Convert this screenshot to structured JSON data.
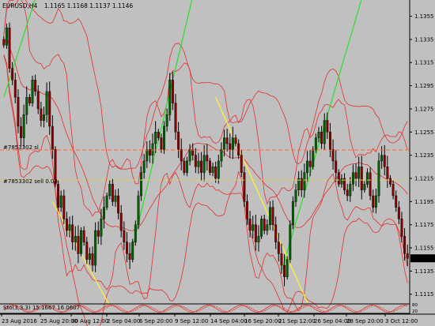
{
  "header": {
    "symbol_tf": "EURUSD,H4",
    "ohlc": "1.1165 1.1168 1.1137 1.1146"
  },
  "orders": {
    "sl_label": "#7853302 sl",
    "sell_label": "#7853302 sell 0.03"
  },
  "current_price": "1.1146",
  "oscillator_label": "Sto(3,3,3) 15.1667 16.0607",
  "osc_levels": [
    "80",
    "20"
  ],
  "colors": {
    "background": "#c0c0c0",
    "bull_candle": "#006400",
    "bear_candle": "#8b0000",
    "bands": "#e03030",
    "green_line": "#33dd33",
    "yellow_line": "#ffee33",
    "sl_line": "#ff6a3d",
    "order_line": "#e0d060",
    "price_box": "#000000"
  },
  "chart_data": {
    "type": "candlestick",
    "symbol": "EURUSD",
    "timeframe": "H4",
    "y_ticks": [
      "1.1355",
      "1.1335",
      "1.1315",
      "1.1295",
      "1.1275",
      "1.1255",
      "1.1235",
      "1.1215",
      "1.1195",
      "1.1175",
      "1.1155",
      "1.1135",
      "1.1115"
    ],
    "x_ticks": [
      "23 Aug 2016",
      "25 Aug 20:00",
      "30 Aug 12:00",
      "2 Sep 04:00",
      "6 Sep 20:00",
      "9 Sep 12:00",
      "14 Sep 04:00",
      "16 Sep 20:00",
      "21 Sep 12:00",
      "26 Sep 04:00",
      "28 Sep 20:00",
      "3 Oct 12:00"
    ],
    "ylim": [
      1.1108,
      1.1369
    ],
    "sl_price": 1.12395,
    "order_price": 1.12135,
    "closes": [
      1.133,
      1.1345,
      1.131,
      1.13,
      1.1285,
      1.126,
      1.125,
      1.127,
      1.1285,
      1.128,
      1.13,
      1.129,
      1.1275,
      1.1265,
      1.127,
      1.129,
      1.126,
      1.124,
      1.121,
      1.119,
      1.12,
      1.118,
      1.117,
      1.1175,
      1.116,
      1.1165,
      1.115,
      1.117,
      1.116,
      1.1145,
      1.115,
      1.114,
      1.117,
      1.1165,
      1.118,
      1.119,
      1.12,
      1.121,
      1.1195,
      1.12,
      1.1185,
      1.117,
      1.116,
      1.115,
      1.1145,
      1.116,
      1.1175,
      1.12,
      1.122,
      1.123,
      1.124,
      1.1235,
      1.1245,
      1.1255,
      1.125,
      1.124,
      1.126,
      1.127,
      1.13,
      1.128,
      1.1255,
      1.124,
      1.123,
      1.122,
      1.123,
      1.124,
      1.1235,
      1.1225,
      1.123,
      1.122,
      1.1235,
      1.123,
      1.122,
      1.1225,
      1.1215,
      1.123,
      1.124,
      1.125,
      1.1245,
      1.124,
      1.125,
      1.1245,
      1.1235,
      1.122,
      1.1195,
      1.118,
      1.117,
      1.1175,
      1.116,
      1.1165,
      1.118,
      1.117,
      1.1175,
      1.119,
      1.1175,
      1.116,
      1.115,
      1.114,
      1.113,
      1.1145,
      1.1175,
      1.1195,
      1.1205,
      1.1215,
      1.1205,
      1.122,
      1.123,
      1.1225,
      1.124,
      1.125,
      1.1255,
      1.1245,
      1.1265,
      1.1255,
      1.124,
      1.123,
      1.122,
      1.121,
      1.1215,
      1.1205,
      1.12,
      1.121,
      1.122,
      1.1215,
      1.1225,
      1.1205,
      1.121,
      1.122,
      1.12,
      1.119,
      1.12,
      1.123,
      1.1235,
      1.1225,
      1.1215,
      1.121,
      1.12,
      1.119,
      1.118,
      1.1165,
      1.115,
      1.1146
    ]
  }
}
